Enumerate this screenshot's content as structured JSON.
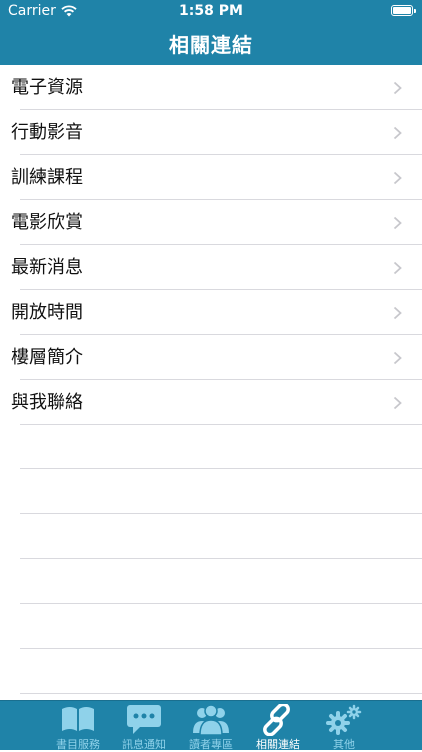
{
  "status_bar": {
    "carrier": "Carrier",
    "time": "1:58 PM"
  },
  "nav": {
    "title": "相關連結"
  },
  "list": {
    "items": [
      {
        "label": "電子資源"
      },
      {
        "label": "行動影音"
      },
      {
        "label": "訓練課程"
      },
      {
        "label": "電影欣賞"
      },
      {
        "label": "最新消息"
      },
      {
        "label": "開放時間"
      },
      {
        "label": "樓層簡介"
      },
      {
        "label": "與我聯絡"
      }
    ]
  },
  "tab_bar": {
    "tabs": [
      {
        "label": "書目服務",
        "icon": "book-icon"
      },
      {
        "label": "訊息通知",
        "icon": "chat-bubble-icon"
      },
      {
        "label": "讀者專區",
        "icon": "users-icon"
      },
      {
        "label": "相關連結",
        "icon": "link-icon",
        "active": true
      },
      {
        "label": "其他",
        "icon": "gears-icon"
      }
    ]
  },
  "colors": {
    "brand": "#1f83a8",
    "tab_inactive": "#8fd2ea",
    "separator": "#d9d9de"
  }
}
